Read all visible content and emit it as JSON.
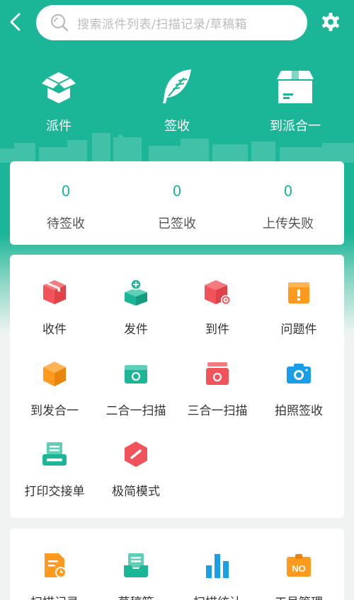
{
  "search": {
    "placeholder": "搜索派件列表/扫描记录/草稿箱"
  },
  "quick_actions": [
    {
      "label": "派件",
      "icon": "open-box-icon"
    },
    {
      "label": "签收",
      "icon": "feather-icon"
    },
    {
      "label": "到派合一",
      "icon": "parcel-box-icon"
    }
  ],
  "stats": [
    {
      "value": "0",
      "label": "待签收"
    },
    {
      "value": "0",
      "label": "已签收"
    },
    {
      "value": "0",
      "label": "上传失败"
    }
  ],
  "functions": [
    {
      "label": "收件",
      "icon": "receive-box-icon",
      "color": "#f0545a"
    },
    {
      "label": "发件",
      "icon": "send-box-icon",
      "color": "#1bb597"
    },
    {
      "label": "到件",
      "icon": "arrive-box-icon",
      "color": "#f0545a"
    },
    {
      "label": "问题件",
      "icon": "problem-box-icon",
      "color": "#ff9a1f"
    },
    {
      "label": "到发合一",
      "icon": "cube-icon",
      "color": "#ff9a1f"
    },
    {
      "label": "二合一扫描",
      "icon": "scan-2in1-icon",
      "color": "#1bb597"
    },
    {
      "label": "三合一扫描",
      "icon": "scan-3in1-icon",
      "color": "#f0545a"
    },
    {
      "label": "拍照签收",
      "icon": "camera-icon",
      "color": "#1a9ee8"
    },
    {
      "label": "打印交接单",
      "icon": "printer-icon",
      "color": "#1bb597"
    },
    {
      "label": "极简模式",
      "icon": "minimal-mode-icon",
      "color": "#f0545a"
    }
  ],
  "tools": [
    {
      "label": "扫描记录",
      "icon": "scan-record-icon",
      "color": "#ff9a1f"
    },
    {
      "label": "草稿箱",
      "icon": "draft-tray-icon",
      "color": "#1bb597"
    },
    {
      "label": "扫描统计",
      "icon": "bar-stats-icon",
      "color": "#1a9ee8"
    },
    {
      "label": "工号管理",
      "icon": "badge-no-icon",
      "color": "#ff9a1f"
    }
  ],
  "badge_text": "NO",
  "colors": {
    "primary": "#1bb597",
    "red": "#f0545a",
    "orange": "#ff9a1f",
    "blue": "#1a9ee8"
  }
}
